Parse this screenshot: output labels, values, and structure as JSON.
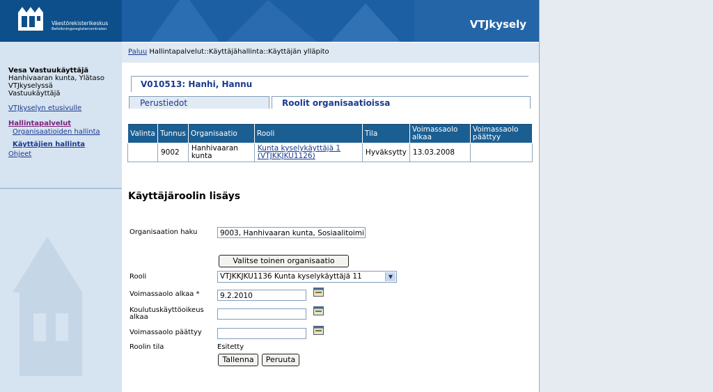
{
  "logo": {
    "name": "Väestörekisterikeskus",
    "subname": "Befolkningsregistercentralen"
  },
  "header": {
    "app_title": "VTJkysely"
  },
  "user": {
    "name": "Vesa Vastuukäyttäjä",
    "line1": "Hanhivaaran kunta, Ylätaso",
    "line2": "VTJkyselyssä",
    "line3": "Vastuukäyttäjä"
  },
  "nav": {
    "front": "VTJkyselyn etusivulle",
    "services": "Hallintapalvelut",
    "orgs": "Organisaatioiden hallinta",
    "users": "Käyttäjien hallinta",
    "help": "Ohjeet"
  },
  "breadcrumb": {
    "back": "Paluu",
    "path": "Hallintapalvelut::Käyttäjähallinta::Käyttäjän ylläpito"
  },
  "person": {
    "title": "V010513: Hanhi, Hannu"
  },
  "tabs": {
    "basic": "Perustiedot",
    "roles": "Roolit organisaatioissa"
  },
  "roles_table": {
    "headers": [
      "Valinta",
      "Tunnus",
      "Organisaatio",
      "Rooli",
      "Tila",
      "Voimassaolo alkaa",
      "Voimassaolo päättyy"
    ],
    "rows": [
      {
        "select": "",
        "id": "9002",
        "org": "Hanhivaaran kunta",
        "role": "Kunta kyselykäyttäjä 1 (VTJKKJKU1126)",
        "state": "Hyväksytty",
        "start": "13.03.2008",
        "end": ""
      }
    ]
  },
  "form": {
    "title": "Käyttäjäroolin lisäys",
    "org_search_label": "Organisaation haku",
    "org_search_value": "9003, Hanhivaaran kunta, Sosiaalitoimi",
    "choose_org_button": "Valitse toinen organisaatio",
    "role_label": "Rooli",
    "role_value": "VTJKKJKU1136 Kunta kyselykäyttäjä 11",
    "start_label": "Voimassaolo alkaa *",
    "start_value": "9.2.2010",
    "training_label": "Koulutuskäyttöoikeus alkaa",
    "training_value": "",
    "end_label": "Voimassaolo päättyy",
    "end_value": "",
    "status_label": "Roolin tila",
    "status_value": "Esitetty",
    "save_button": "Tallenna",
    "cancel_button": "Peruuta"
  }
}
